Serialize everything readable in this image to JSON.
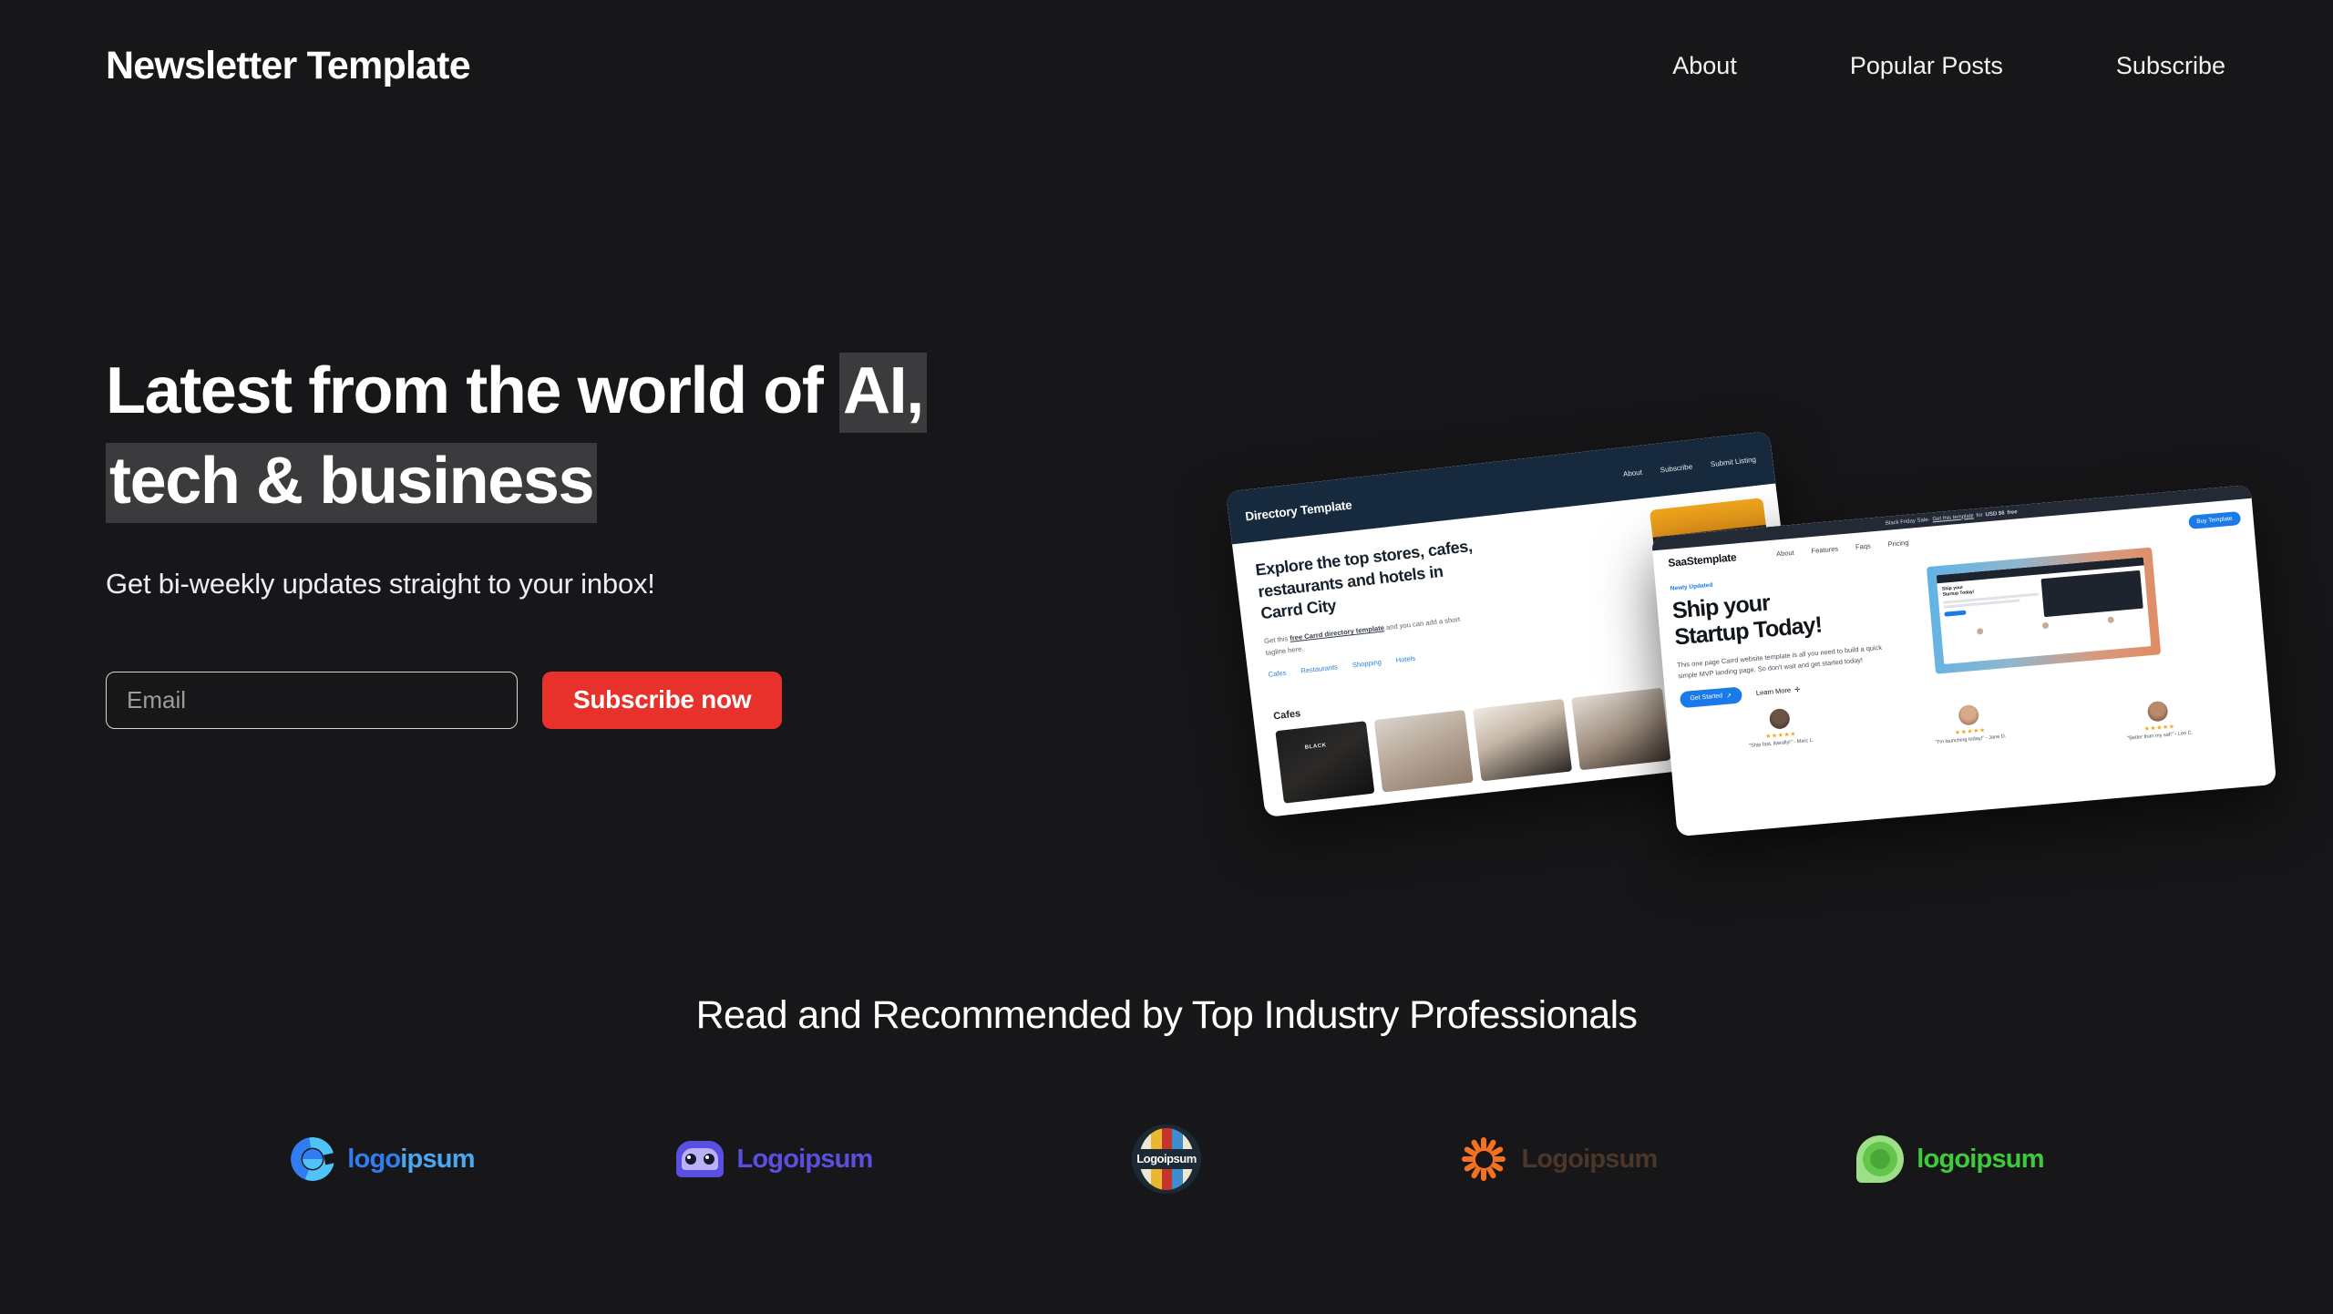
{
  "header": {
    "brand": "Newsletter Template",
    "nav": [
      {
        "label": "About"
      },
      {
        "label": "Popular Posts"
      },
      {
        "label": "Subscribe"
      }
    ]
  },
  "hero": {
    "headline_part1": "Latest from the world of ",
    "headline_highlight1": "AI,",
    "headline_highlight2": "tech & business",
    "subhead": "Get bi-weekly updates straight to your inbox!",
    "email_placeholder": "Email",
    "email_value": "",
    "subscribe_label": "Subscribe now",
    "accent_color": "#e8312a",
    "background_color": "#171719",
    "highlight_color": "#3b3b3d"
  },
  "hero_art": {
    "directory": {
      "brand": "Directory Template",
      "nav": [
        {
          "label": "About"
        },
        {
          "label": "Subscribe"
        },
        {
          "label": "Submit Listing"
        }
      ],
      "heading": "Explore the top stores, cafes, restaurants and hotels in Carrd City",
      "body_pre": "Get this ",
      "body_link": "free Carrd directory template",
      "body_post": " and you can add a short tagline here.",
      "categories": [
        {
          "label": "Cafes"
        },
        {
          "label": "Restaurants"
        },
        {
          "label": "Shopping"
        },
        {
          "label": "Hotels"
        }
      ],
      "restaurants_link": "Restaurants",
      "cafes_label": "Cafes",
      "thumb_caption": "BLACK"
    },
    "saas": {
      "banner_pre": "Black Friday Sale-",
      "banner_link": "Get this template",
      "banner_mid": "for",
      "banner_price": "USD $6",
      "banner_post": "free",
      "brand": "SaaStemplate",
      "nav": [
        {
          "label": "About"
        },
        {
          "label": "Features"
        },
        {
          "label": "Faqs"
        },
        {
          "label": "Pricing"
        }
      ],
      "buy_label": "Buy Template",
      "badge": "Newly Updated",
      "heading_line1": "Ship your",
      "heading_line2": "Startup Today!",
      "body": "This one page Carrd website template is all you need to build a quick simple MVP landing page. So don't wait and get started today!",
      "cta_primary": "Get Started",
      "cta_secondary": "Learn More",
      "preview_heading_line1": "Ship your",
      "preview_heading_line2": "Startup Today!",
      "testimonials": [
        {
          "stars": "★★★★★",
          "text": "\"Ship fast, literally!\" - Marc L."
        },
        {
          "stars": "★★★★★",
          "text": "\"I'm launching today!\" - Jane D."
        },
        {
          "stars": "★★★★★",
          "text": "\"Better than my saf!\" - Leo C."
        }
      ]
    }
  },
  "proof": {
    "title": "Read and Recommended by Top Industry Professionals",
    "logos": [
      {
        "name": "logoipsum-donut",
        "text_a": "logo",
        "text_b": "ipsum",
        "color": "#2f7df0"
      },
      {
        "name": "logoipsum-robot",
        "text": "Logoipsum",
        "color": "#5b4fe0"
      },
      {
        "name": "logoipsum-badge",
        "text": "Logoipsum",
        "color": "#ffffff"
      },
      {
        "name": "logoipsum-sunburst",
        "text": "Logoipsum",
        "color": "#4a3728"
      },
      {
        "name": "logoipsum-bubble",
        "text": "logoipsum",
        "color": "#3ecb3b"
      }
    ]
  }
}
